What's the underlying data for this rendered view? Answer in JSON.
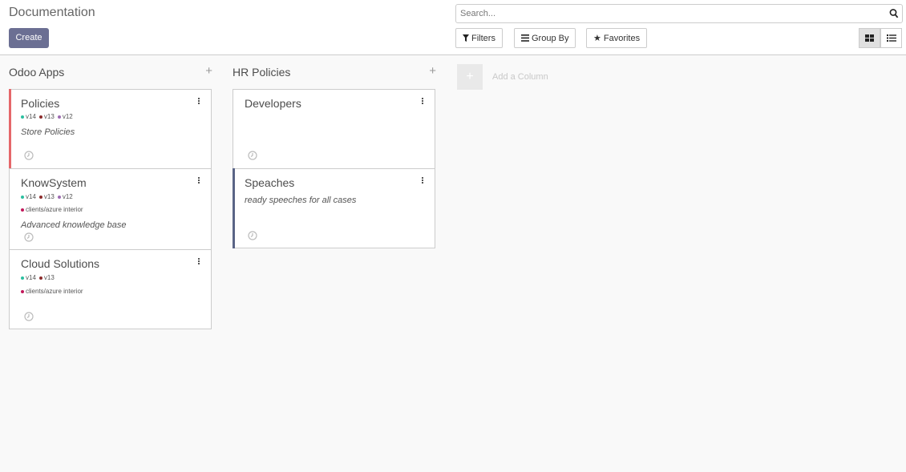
{
  "header": {
    "title": "Documentation",
    "create_label": "Create"
  },
  "search": {
    "placeholder": "Search..."
  },
  "filters": {
    "filters_label": "Filters",
    "groupby_label": "Group By",
    "favorites_label": "Favorites"
  },
  "colors": {
    "accent": "#6b6f93",
    "v14": "#2bbf9f",
    "v13": "#8c2b2b",
    "v12": "#9e6bb3",
    "client": "#c2185b",
    "card_red": "#e5676a",
    "card_blue": "#5a6486"
  },
  "columns": [
    {
      "title": "Odoo Apps",
      "cards": [
        {
          "title": "Policies",
          "tags": [
            "v14",
            "v13",
            "v12"
          ],
          "tags2": [],
          "desc": "Store Policies"
        },
        {
          "title": "KnowSystem",
          "tags": [
            "v14",
            "v13",
            "v12"
          ],
          "tags2": [
            "clients/azure interior"
          ],
          "desc": "Advanced knowledge base"
        },
        {
          "title": "Cloud Solutions",
          "tags": [
            "v14",
            "v13"
          ],
          "tags2": [
            "clients/azure interior"
          ],
          "desc": ""
        }
      ]
    },
    {
      "title": "HR Policies",
      "cards": [
        {
          "title": "Developers",
          "tags": [],
          "tags2": [],
          "desc": ""
        },
        {
          "title": "Speaches",
          "tags": [],
          "tags2": [],
          "desc": "ready speeches for all cases"
        }
      ]
    }
  ],
  "add_column_label": "Add a Column"
}
